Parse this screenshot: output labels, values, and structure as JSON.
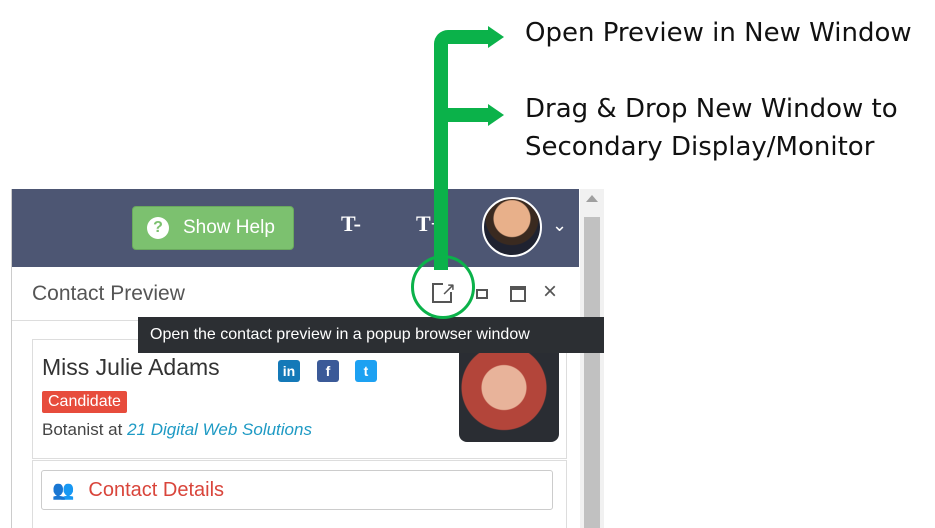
{
  "annotations": {
    "callout_1": "Open Preview in New Window",
    "callout_2_line_1": "Drag & Drop New Window to",
    "callout_2_line_2": "Secondary Display/Monitor",
    "highlight_color": "#0bb24a"
  },
  "topbar": {
    "help_label": "Show Help",
    "help_icon": "?",
    "font_decrease_label": "T-",
    "font_increase_label": "T+",
    "avatar_chevron": "⌄"
  },
  "panel": {
    "title": "Contact Preview",
    "tooltip": "Open the contact preview in a popup browser window",
    "icons": [
      "popout-icon",
      "pin-icon",
      "maximize-icon",
      "close-icon"
    ]
  },
  "contact": {
    "name": "Miss Julie Adams",
    "badge": "Candidate",
    "job_prefix": "Botanist at ",
    "company": "21 Digital Web Solutions",
    "social": {
      "linkedin": "in",
      "facebook": "f",
      "twitter": "t"
    }
  },
  "sections": {
    "contact_details": "Contact Details"
  },
  "colors": {
    "topbar": "#4d5673",
    "help_button": "#7cc16f",
    "badge": "#e74c3c",
    "section_accent": "#d9453b",
    "link": "#1e9ac4"
  }
}
